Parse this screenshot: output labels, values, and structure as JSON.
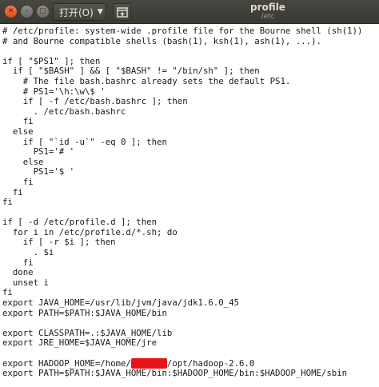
{
  "window": {
    "title": "profile",
    "subtitle": "/etc",
    "open_label": "打开(O)",
    "controls": {
      "close": "✕",
      "minimize": "–",
      "maximize": "□"
    },
    "colors": {
      "titlebar": "#3c3b37",
      "close": "#e95420",
      "text": "#1a1a1a"
    }
  },
  "editor": {
    "lines": [
      "# /etc/profile: system-wide .profile file for the Bourne shell (sh(1))",
      "# and Bourne compatible shells (bash(1), ksh(1), ash(1), ...).",
      "",
      "if [ \"$PS1\" ]; then",
      "  if [ \"$BASH\" ] && [ \"$BASH\" != \"/bin/sh\" ]; then",
      "    # The file bash.bashrc already sets the default PS1.",
      "    # PS1='\\h:\\w\\$ '",
      "    if [ -f /etc/bash.bashrc ]; then",
      "      . /etc/bash.bashrc",
      "    fi",
      "  else",
      "    if [ \"`id -u`\" -eq 0 ]; then",
      "      PS1='# '",
      "    else",
      "      PS1='$ '",
      "    fi",
      "  fi",
      "fi",
      "",
      "if [ -d /etc/profile.d ]; then",
      "  for i in /etc/profile.d/*.sh; do",
      "    if [ -r $i ]; then",
      "      . $i",
      "    fi",
      "  done",
      "  unset i",
      "fi",
      "export JAVA_HOME=/usr/lib/jvm/java/jdk1.6.0_45",
      "export PATH=$PATH:$JAVA_HOME/bin",
      "",
      "export CLASSPATH=.:$JAVA_HOME/lib",
      "export JRE_HOME=$JAVA_HOME/jre",
      "",
      "export HADOOP_HOME=/home/",
      "export PATH=$PATH:$JAVA_HOME/bin:$HADOOP_HOME/bin:$HADOOP_HOME/sbin"
    ],
    "hadoop_suffix": "/opt/hadoop-2.6.0",
    "redacted_text": "xxxxxxx"
  }
}
